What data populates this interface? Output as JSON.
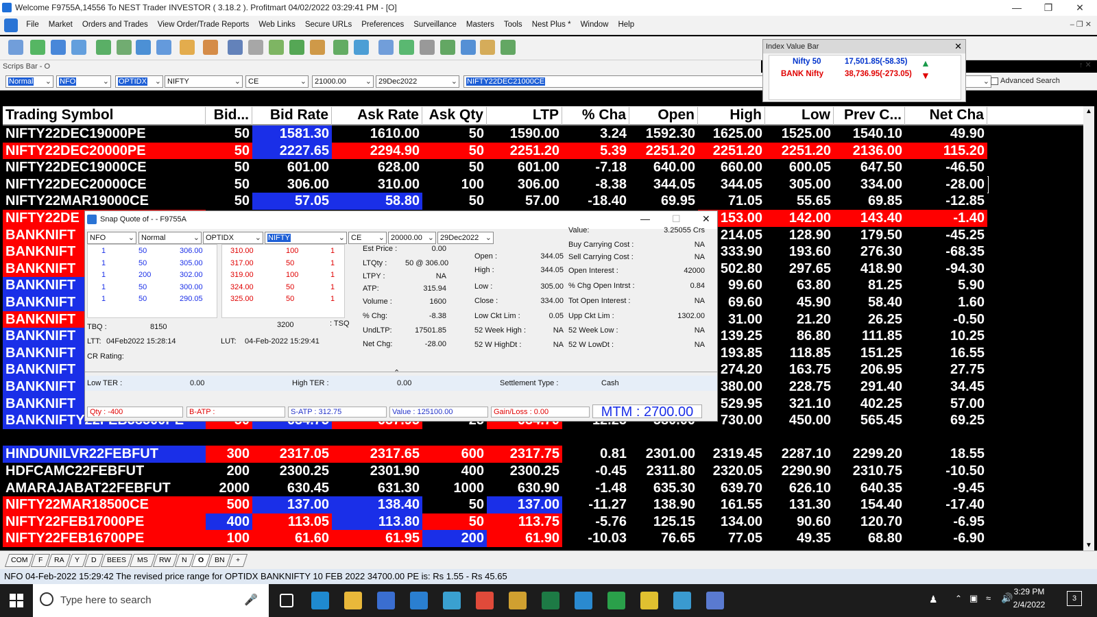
{
  "window": {
    "title": "Welcome F9755A,14556 To NEST Trader INVESTOR ( 3.18.2 ).  Profitmart 04/02/2022 03:29:41 PM - [O]"
  },
  "menu": [
    "File",
    "Market",
    "Orders and Trades",
    "View Order/Trade Reports",
    "Web Links",
    "Secure URLs",
    "Preferences",
    "Surveillance",
    "Masters",
    "Tools",
    "Nest Plus *",
    "Window",
    "Help"
  ],
  "scrips": {
    "label": "Scrips Bar - O",
    "type": "Normal",
    "exchange": "NFO",
    "instrument": "OPTIDX",
    "symbol": "NIFTY",
    "opt": "CE",
    "strike": "21000.00",
    "expiry": "29Dec2022",
    "token": "NIFTY22DEC21000CE",
    "advanced": "Advanced Search"
  },
  "index": {
    "title": "Index Value Bar",
    "n1": "Nifty 50",
    "v1": "17,501.85(-58.35)",
    "n2": "BANK Nifty",
    "v2": "38,736.95(-273.05)",
    "colors": {
      "up": "#1a9a4a",
      "down": "#e00000"
    }
  },
  "headers": [
    "Trading Symbol",
    "Bid...",
    "Bid Rate",
    "Ask Rate",
    "Ask Qty",
    "LTP",
    "% Cha",
    "Open",
    "High",
    "Low",
    "Prev C...",
    "Net Cha"
  ],
  "rows": [
    {
      "c": [
        "NIFTY22DEC19000PE",
        "50",
        "1581.30",
        "1610.00",
        "50",
        "1590.00",
        "3.24",
        "1592.30",
        "1625.00",
        "1525.00",
        "1540.10",
        "49.90"
      ],
      "bg": [
        "#000",
        "#000",
        "#1a2fe8",
        "#000",
        "#000",
        "#000",
        "#000",
        "#000",
        "#000",
        "#000",
        "#000",
        "#000"
      ]
    },
    {
      "c": [
        "NIFTY22DEC20000PE",
        "50",
        "2227.65",
        "2294.90",
        "50",
        "2251.20",
        "5.39",
        "2251.20",
        "2251.20",
        "2251.20",
        "2136.00",
        "115.20"
      ],
      "bg": [
        "#f00",
        "#f00",
        "#1a2fe8",
        "#f00",
        "#f00",
        "#f00",
        "#f00",
        "#f00",
        "#f00",
        "#f00",
        "#f00",
        "#f00"
      ]
    },
    {
      "c": [
        "NIFTY22DEC19000CE",
        "50",
        "601.00",
        "628.00",
        "50",
        "601.00",
        "-7.18",
        "640.00",
        "660.00",
        "600.05",
        "647.50",
        "-46.50"
      ],
      "bg": [
        "#000",
        "#000",
        "#000",
        "#000",
        "#000",
        "#000",
        "#000",
        "#000",
        "#000",
        "#000",
        "#000",
        "#000"
      ]
    },
    {
      "c": [
        "NIFTY22DEC20000CE",
        "50",
        "306.00",
        "310.00",
        "100",
        "306.00",
        "-8.38",
        "344.05",
        "344.05",
        "305.00",
        "334.00",
        "-28.00"
      ],
      "bg": [
        "#000",
        "#000",
        "#000",
        "#000",
        "#000",
        "#000",
        "#000",
        "#000",
        "#000",
        "#000",
        "#000",
        "#000"
      ],
      "outline": true
    },
    {
      "c": [
        "NIFTY22MAR19000CE",
        "50",
        "57.05",
        "58.80",
        "50",
        "57.00",
        "-18.40",
        "69.95",
        "71.05",
        "55.65",
        "69.85",
        "-12.85"
      ],
      "bg": [
        "#000",
        "#000",
        "#1a2fe8",
        "#1a2fe8",
        "#000",
        "#000",
        "#000",
        "#000",
        "#000",
        "#000",
        "#000",
        "#000"
      ]
    },
    {
      "c": [
        "NIFTY22DE",
        "",
        "",
        "",
        "",
        "",
        "",
        "",
        "153.00",
        "142.00",
        "143.40",
        "-1.40"
      ],
      "bg": [
        "#f00",
        "#000",
        "#000",
        "#000",
        "#000",
        "#000",
        "#000",
        "#000",
        "#f00",
        "#f00",
        "#f00",
        "#f00"
      ]
    },
    {
      "c": [
        "BANKNIFT",
        "",
        "",
        "",
        "",
        "",
        "",
        "",
        "214.05",
        "128.90",
        "179.50",
        "-45.25"
      ],
      "bg": [
        "#f00",
        "#000",
        "#000",
        "#000",
        "#000",
        "#000",
        "#000",
        "#000",
        "#000",
        "#000",
        "#000",
        "#000"
      ]
    },
    {
      "c": [
        "BANKNIFT",
        "",
        "",
        "",
        "",
        "",
        "",
        "",
        "333.90",
        "193.60",
        "276.30",
        "-68.35"
      ],
      "bg": [
        "#f00",
        "#000",
        "#000",
        "#000",
        "#000",
        "#000",
        "#000",
        "#000",
        "#000",
        "#000",
        "#000",
        "#000"
      ]
    },
    {
      "c": [
        "BANKNIFT",
        "",
        "",
        "",
        "",
        "",
        "",
        "",
        "502.80",
        "297.65",
        "418.90",
        "-94.30"
      ],
      "bg": [
        "#f00",
        "#000",
        "#000",
        "#000",
        "#000",
        "#000",
        "#000",
        "#000",
        "#000",
        "#000",
        "#000",
        "#000"
      ]
    },
    {
      "c": [
        "BANKNIFT",
        "",
        "",
        "",
        "",
        "",
        "",
        "",
        "99.60",
        "63.80",
        "81.25",
        "5.90"
      ],
      "bg": [
        "#1a2fe8",
        "#000",
        "#000",
        "#000",
        "#000",
        "#000",
        "#000",
        "#000",
        "#000",
        "#000",
        "#000",
        "#000"
      ]
    },
    {
      "c": [
        "BANKNIFT",
        "",
        "",
        "",
        "",
        "",
        "",
        "",
        "69.60",
        "45.90",
        "58.40",
        "1.60"
      ],
      "bg": [
        "#1a2fe8",
        "#000",
        "#000",
        "#000",
        "#000",
        "#000",
        "#000",
        "#000",
        "#000",
        "#000",
        "#000",
        "#000"
      ]
    },
    {
      "c": [
        "BANKNIFT",
        "",
        "",
        "",
        "",
        "",
        "",
        "",
        "31.00",
        "21.20",
        "26.25",
        "-0.50"
      ],
      "bg": [
        "#f00",
        "#000",
        "#000",
        "#000",
        "#000",
        "#000",
        "#000",
        "#000",
        "#000",
        "#000",
        "#000",
        "#000"
      ]
    },
    {
      "c": [
        "BANKNIFT",
        "",
        "",
        "",
        "",
        "",
        "",
        "",
        "139.25",
        "86.80",
        "111.85",
        "10.25"
      ],
      "bg": [
        "#1a2fe8",
        "#000",
        "#000",
        "#000",
        "#000",
        "#000",
        "#000",
        "#000",
        "#000",
        "#000",
        "#000",
        "#000"
      ]
    },
    {
      "c": [
        "BANKNIFT",
        "",
        "",
        "",
        "",
        "",
        "",
        "",
        "193.85",
        "118.85",
        "151.25",
        "16.55"
      ],
      "bg": [
        "#1a2fe8",
        "#000",
        "#000",
        "#000",
        "#000",
        "#000",
        "#000",
        "#000",
        "#000",
        "#000",
        "#000",
        "#000"
      ]
    },
    {
      "c": [
        "BANKNIFT",
        "",
        "",
        "",
        "",
        "",
        "",
        "",
        "274.20",
        "163.75",
        "206.95",
        "27.75"
      ],
      "bg": [
        "#1a2fe8",
        "#000",
        "#000",
        "#000",
        "#000",
        "#000",
        "#000",
        "#000",
        "#000",
        "#000",
        "#000",
        "#000"
      ]
    },
    {
      "c": [
        "BANKNIFT",
        "",
        "",
        "",
        "",
        "",
        "",
        "",
        "380.00",
        "228.75",
        "291.40",
        "34.45"
      ],
      "bg": [
        "#1a2fe8",
        "#000",
        "#000",
        "#000",
        "#000",
        "#000",
        "#000",
        "#000",
        "#000",
        "#000",
        "#000",
        "#000"
      ]
    },
    {
      "c": [
        "BANKNIFT",
        "",
        "",
        "",
        "",
        "",
        "",
        "",
        "529.95",
        "321.10",
        "402.25",
        "57.00"
      ],
      "bg": [
        "#1a2fe8",
        "#000",
        "#000",
        "#000",
        "#000",
        "#000",
        "#000",
        "#000",
        "#000",
        "#000",
        "#000",
        "#000"
      ]
    },
    {
      "c": [
        "BANKNIFTY22FEB38500PE",
        "50",
        "634.75",
        "637.95",
        "25",
        "634.70",
        "12.25",
        "580.00",
        "730.00",
        "450.00",
        "565.45",
        "69.25"
      ],
      "bg": [
        "#1a2fe8",
        "#f00",
        "#1a2fe8",
        "#f00",
        "#000",
        "#f00",
        "#000",
        "#000",
        "#000",
        "#000",
        "#000",
        "#000"
      ]
    },
    {
      "c": [
        "",
        "",
        "",
        "",
        "",
        "",
        "",
        "",
        "",
        "",
        "",
        ""
      ],
      "bg": [
        "#000",
        "#000",
        "#000",
        "#000",
        "#000",
        "#000",
        "#000",
        "#000",
        "#000",
        "#000",
        "#000",
        "#000"
      ]
    },
    {
      "c": [
        "HINDUNILVR22FEBFUT",
        "300",
        "2317.05",
        "2317.65",
        "600",
        "2317.75",
        "0.81",
        "2301.00",
        "2319.45",
        "2287.10",
        "2299.20",
        "18.55"
      ],
      "bg": [
        "#1a2fe8",
        "#f00",
        "#f00",
        "#f00",
        "#f00",
        "#f00",
        "#000",
        "#000",
        "#000",
        "#000",
        "#000",
        "#000"
      ]
    },
    {
      "c": [
        "HDFCAMC22FEBFUT",
        "200",
        "2300.25",
        "2301.90",
        "400",
        "2300.25",
        "-0.45",
        "2311.80",
        "2320.05",
        "2290.90",
        "2310.75",
        "-10.50"
      ],
      "bg": [
        "#000",
        "#000",
        "#000",
        "#000",
        "#000",
        "#000",
        "#000",
        "#000",
        "#000",
        "#000",
        "#000",
        "#000"
      ]
    },
    {
      "c": [
        "AMARAJABAT22FEBFUT",
        "2000",
        "630.45",
        "631.30",
        "1000",
        "630.90",
        "-1.48",
        "635.30",
        "639.70",
        "626.10",
        "640.35",
        "-9.45"
      ],
      "bg": [
        "#000",
        "#000",
        "#000",
        "#000",
        "#000",
        "#000",
        "#000",
        "#000",
        "#000",
        "#000",
        "#000",
        "#000"
      ]
    },
    {
      "c": [
        "NIFTY22MAR18500CE",
        "500",
        "137.00",
        "138.40",
        "50",
        "137.00",
        "-11.27",
        "138.90",
        "161.55",
        "131.30",
        "154.40",
        "-17.40"
      ],
      "bg": [
        "#f00",
        "#f00",
        "#1a2fe8",
        "#1a2fe8",
        "#000",
        "#1a2fe8",
        "#000",
        "#000",
        "#000",
        "#000",
        "#000",
        "#000"
      ]
    },
    {
      "c": [
        "NIFTY22FEB17000PE",
        "400",
        "113.05",
        "113.80",
        "50",
        "113.75",
        "-5.76",
        "125.15",
        "134.00",
        "90.60",
        "120.70",
        "-6.95"
      ],
      "bg": [
        "#f00",
        "#1a2fe8",
        "#f00",
        "#1a2fe8",
        "#f00",
        "#f00",
        "#000",
        "#000",
        "#000",
        "#000",
        "#000",
        "#000"
      ]
    },
    {
      "c": [
        "NIFTY22FEB16700PE",
        "100",
        "61.60",
        "61.95",
        "200",
        "61.90",
        "-10.03",
        "76.65",
        "77.05",
        "49.35",
        "68.80",
        "-6.90"
      ],
      "bg": [
        "#f00",
        "#f00",
        "#f00",
        "#f00",
        "#1a2fe8",
        "#f00",
        "#000",
        "#000",
        "#000",
        "#000",
        "#000",
        "#000"
      ]
    }
  ],
  "snap": {
    "title": "Snap Quote of  -  - F9755A",
    "exch": "NFO",
    "type": "Normal",
    "inst": "OPTIDX",
    "sym": "NIFTY",
    "opt": "CE",
    "strike": "20000.00",
    "expiry": "29Dec2022",
    "bids": [
      [
        "1",
        "50",
        "306.00"
      ],
      [
        "1",
        "50",
        "305.00"
      ],
      [
        "1",
        "200",
        "302.00"
      ],
      [
        "1",
        "50",
        "300.00"
      ],
      [
        "1",
        "50",
        "290.05"
      ]
    ],
    "asks": [
      [
        "310.00",
        "100",
        "1"
      ],
      [
        "317.00",
        "50",
        "1"
      ],
      [
        "319.00",
        "100",
        "1"
      ],
      [
        "324.00",
        "50",
        "1"
      ],
      [
        "325.00",
        "50",
        "1"
      ]
    ],
    "tbq_l": "TBQ :",
    "tbq": "8150",
    "tsq": "3200",
    "tsq_l": ": TSQ",
    "ltt_l": "LTT:",
    "ltt": "04Feb2022 15:28:14",
    "lut_l": "LUT:",
    "lut": "04-Feb-2022 15:29:41",
    "cr_l": "CR Rating:",
    "f1": [
      [
        "Est Price :",
        "0.00"
      ],
      [
        "LTQty :",
        "50 @ 306.00"
      ],
      [
        "LTPY :",
        "NA"
      ],
      [
        "ATP:",
        "315.94"
      ],
      [
        "Volume :",
        "1600"
      ],
      [
        "% Chg:",
        "-8.38"
      ],
      [
        "UndLTP:",
        "17501.85"
      ],
      [
        "Net Chg:",
        "-28.00"
      ]
    ],
    "f2": [
      [
        "Open :",
        "344.05"
      ],
      [
        "High :",
        "344.05"
      ],
      [
        "Low :",
        "305.00"
      ],
      [
        "Close :",
        "334.00"
      ],
      [
        "Low Ckt Lim :",
        "0.05"
      ],
      [
        "52 Week High :",
        "NA"
      ],
      [
        "52 W HighDt :",
        "NA"
      ]
    ],
    "f3": [
      [
        "Value:",
        "3.25055 Crs"
      ],
      [
        "Buy Carrying Cost :",
        "NA"
      ],
      [
        "Sell Carrying Cost :",
        "NA"
      ],
      [
        "Open Interest :",
        "42000"
      ],
      [
        "% Chg Open Intrst :",
        "0.84"
      ],
      [
        "Tot Open Interest :",
        "NA"
      ],
      [
        "Upp Ckt Lim :",
        "1302.00"
      ],
      [
        "52 Week Low :",
        "NA"
      ],
      [
        "52 W LowDt :",
        "NA"
      ]
    ],
    "lowter_l": "Low TER :",
    "lowter": "0.00",
    "highter_l": "High TER :",
    "highter": "0.00",
    "sett_l": "Settlement Type :",
    "sett": "Cash",
    "qty": "Qty : -400",
    "batp": "B-ATP :",
    "satp": "S-ATP : 312.75",
    "value": "Value : 125100.00",
    "gain": "Gain/Loss : 0.00",
    "mtm": "MTM : 2700.00"
  },
  "tabs": [
    "COM",
    "F",
    "RA",
    "Y",
    "D",
    "BEES",
    "MS",
    "RW",
    "N",
    "O",
    "BN",
    "+"
  ],
  "status": "NFO 04-Feb-2022 15:29:42 The revised price range for OPTIDX BANKNIFTY 10 FEB 2022 34700.00 PE is: Rs 1.55 - Rs 45.65",
  "taskbar": {
    "search": "Type here to search",
    "time": "3:29 PM",
    "date": "2/4/2022",
    "notif": "3"
  }
}
